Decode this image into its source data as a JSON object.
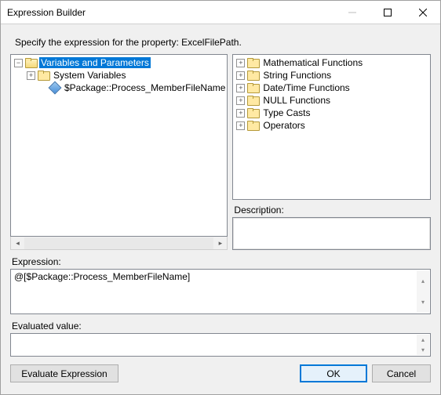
{
  "title": "Expression Builder",
  "instruction": "Specify the expression for the property: ExcelFilePath.",
  "vars_tree": {
    "root": {
      "label": "Variables and Parameters",
      "expanded": true,
      "selected": true
    },
    "system": {
      "label": "System Variables",
      "expanded": false
    },
    "pkg": {
      "label": "$Package::Process_MemberFileName"
    }
  },
  "funcs": [
    "Mathematical Functions",
    "String Functions",
    "Date/Time Functions",
    "NULL Functions",
    "Type Casts",
    "Operators"
  ],
  "labels": {
    "description": "Description:",
    "expression": "Expression:",
    "evaluated": "Evaluated value:",
    "evaluate_btn": "Evaluate Expression",
    "ok": "OK",
    "cancel": "Cancel"
  },
  "expression_value": "@[$Package::Process_MemberFileName]",
  "evaluated_value": ""
}
